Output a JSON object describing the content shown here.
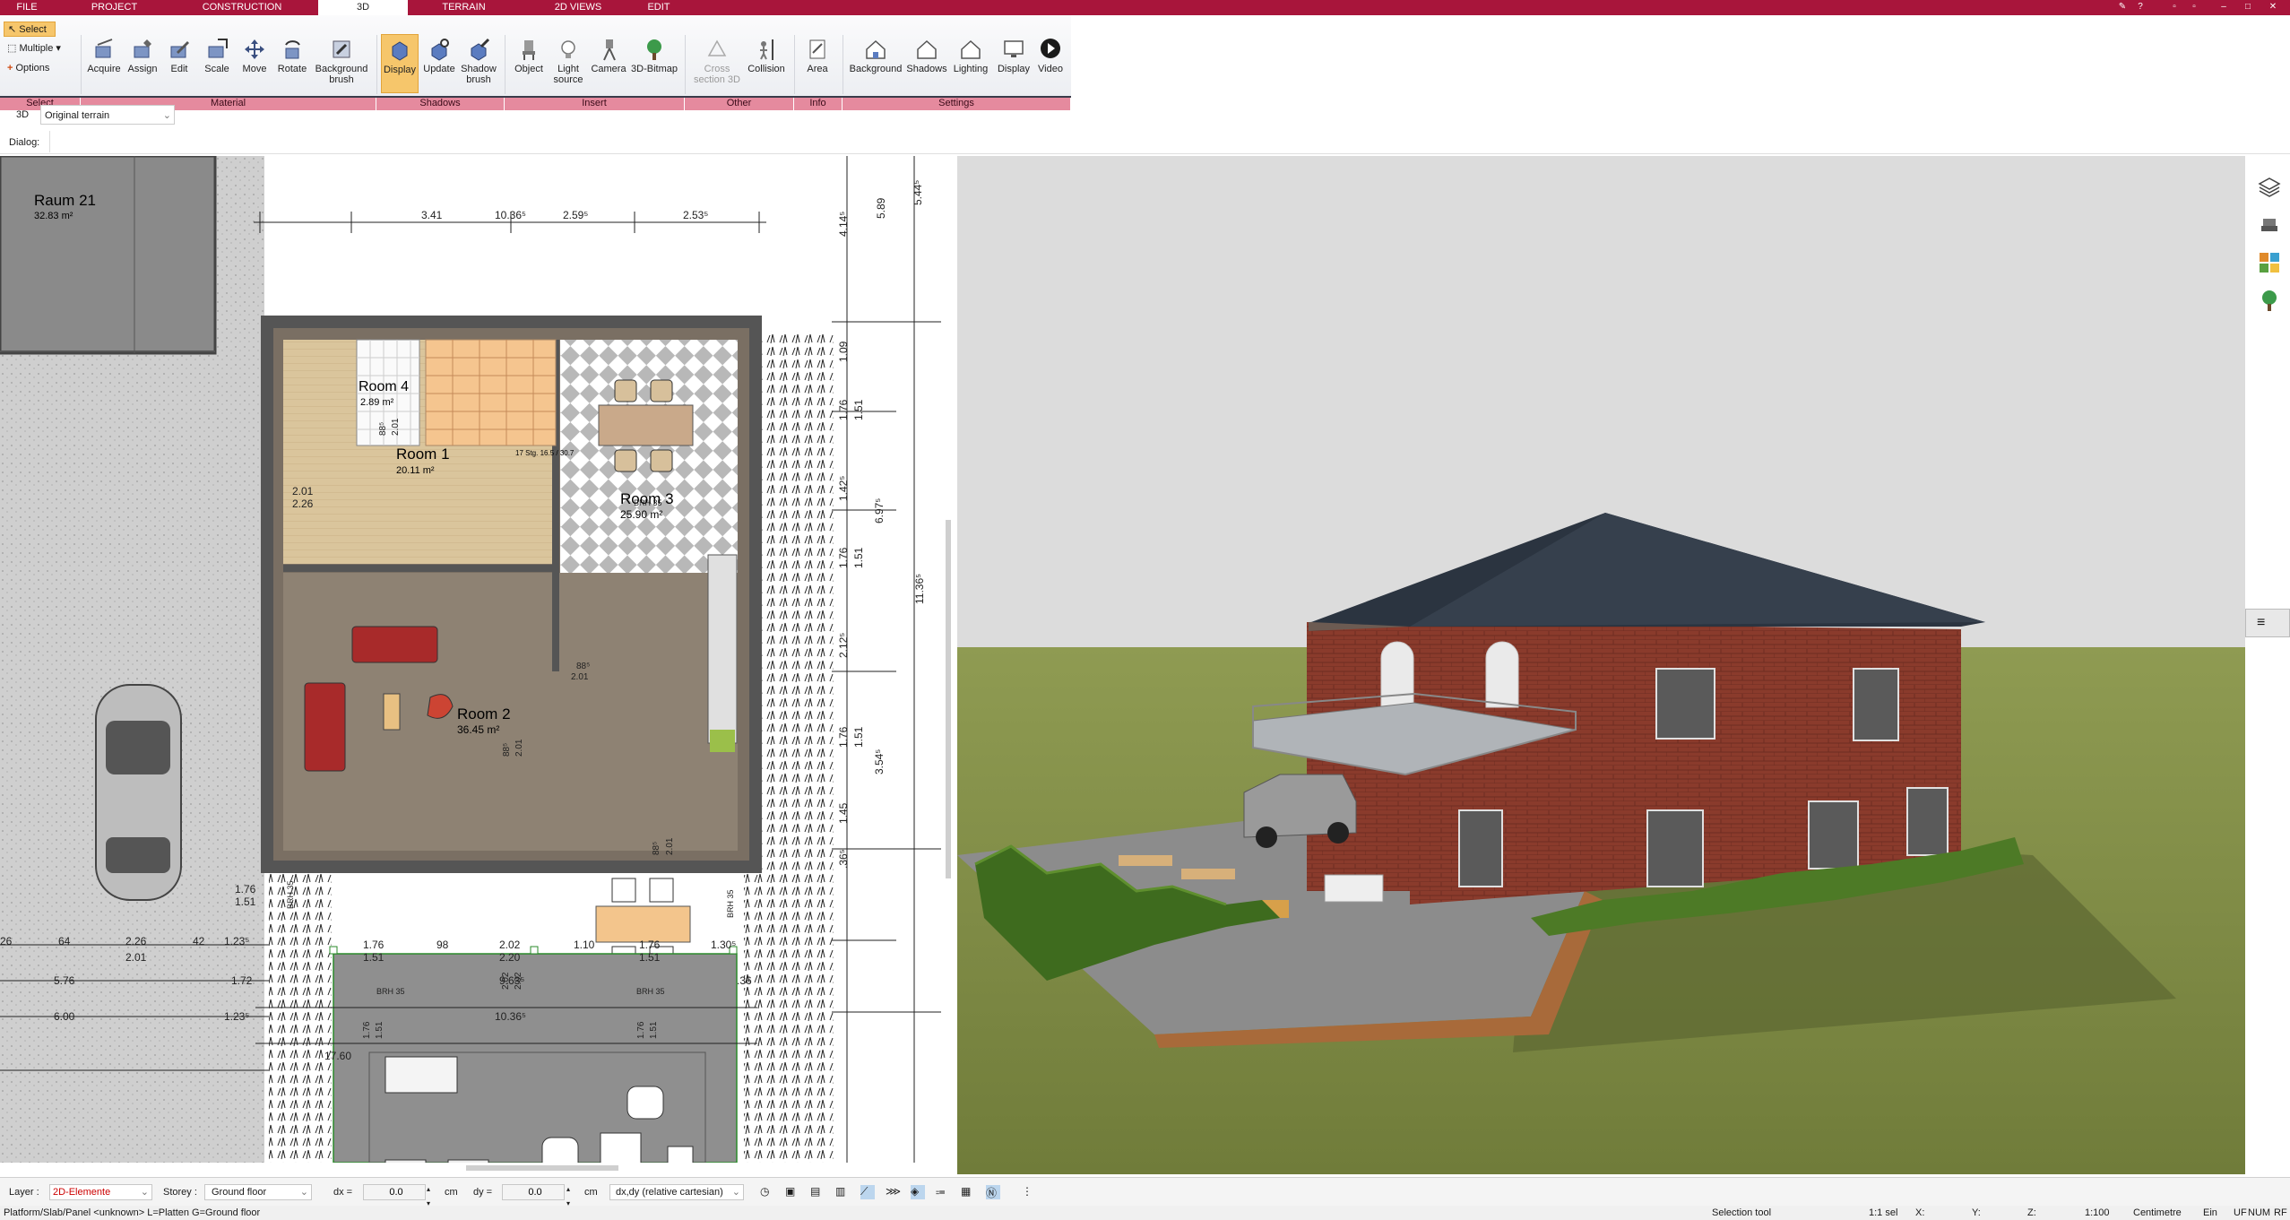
{
  "menu_tabs": [
    {
      "label": "FILE",
      "active": false
    },
    {
      "label": "PROJECT",
      "active": false
    },
    {
      "label": "CONSTRUCTION",
      "active": false
    },
    {
      "label": "3D",
      "active": true
    },
    {
      "label": "TERRAIN",
      "active": false
    },
    {
      "label": "2D VIEWS",
      "active": false
    },
    {
      "label": "EDIT",
      "active": false
    }
  ],
  "select_group": {
    "select": "Select",
    "multiple": "Multiple",
    "options": "Options",
    "group_label": "Select"
  },
  "ribbon": {
    "acquire": "Acquire",
    "assign": "Assign",
    "edit": "Edit",
    "scale": "Scale",
    "move": "Move",
    "rotate": "Rotate",
    "background_brush": "Background brush",
    "display": "Display",
    "update": "Update",
    "shadow_brush": "Shadow brush",
    "object": "Object",
    "light_source": "Light source",
    "camera": "Camera",
    "bitmap_3d": "3D-Bitmap",
    "cross_section": "Cross section 3D",
    "collision": "Collision",
    "area": "Area",
    "background": "Background",
    "shadows": "Shadows",
    "lighting": "Lighting",
    "display2": "Display",
    "video": "Video"
  },
  "groups": {
    "select": "Select",
    "material": "Material",
    "shadows": "Shadows",
    "insert": "Insert",
    "other": "Other",
    "info": "Info",
    "settings": "Settings"
  },
  "view_mode": "3D",
  "terrain_select": "Original terrain",
  "dialog_label": "Dialog:",
  "plan": {
    "rooms": [
      {
        "name": "Raum 21",
        "area": "32.83 m²"
      },
      {
        "name": "Room 4",
        "area": "2.89 m²"
      },
      {
        "name": "Room 1",
        "area": "20.11 m²"
      },
      {
        "name": "Room 3",
        "area": "25.90 m²"
      },
      {
        "name": "Room 2",
        "area": "36.45 m²"
      }
    ],
    "dims_top": [
      "3.41",
      "10.36⁵",
      "2.59⁵",
      "2.53⁵"
    ],
    "dims_right": [
      "5.89",
      "5.44⁵",
      "4.14⁵",
      "1.09",
      "1.76",
      "1.51",
      "1.42⁵",
      "6.97⁵",
      "1.76",
      "1.51",
      "2.12⁵",
      "11.36⁵",
      "1.76",
      "1.51",
      "3.54⁵",
      "1.45",
      ".36⁵"
    ],
    "dims_bottom_left": [
      "26",
      "64",
      "2.26",
      "42",
      "1.23⁵",
      "2.01",
      "5.76",
      "1.72",
      "6.00",
      "1.23⁵"
    ],
    "dims_bottom_mid": [
      "1.76",
      "98",
      "2.02",
      "1.10",
      "1.76",
      "1.30⁵",
      "1.51",
      "2.20",
      "1.51",
      "9.63⁵",
      "10.36⁵",
      "17.60",
      ".36"
    ],
    "door_labels": [
      "2.01",
      "2.26",
      "88⁵",
      "2.01",
      "88⁵",
      "2.01",
      "88⁵",
      "2.01",
      "88⁵",
      "2.01",
      "1.76",
      "1.51",
      "2.02",
      "2.02",
      "1.76",
      "1.51",
      "1.76",
      "1.51"
    ],
    "brh_labels": [
      "BRH 35",
      "BRH 35",
      "BRH 35",
      "BRH 35",
      "BRH 35"
    ],
    "stair_text": "17 Stg.\n16.5 / 30.7"
  },
  "status": {
    "layer_label": "Layer :",
    "layer_value": "2D-Elemente",
    "storey_label": "Storey :",
    "storey_value": "Ground floor",
    "dx_label": "dx =",
    "dx_value": "0.0",
    "dx_unit": "cm",
    "dy_label": "dy =",
    "dy_value": "0.0",
    "dy_unit": "cm",
    "coord_mode": "dx,dy (relative cartesian)"
  },
  "footer": {
    "left": "Platform/Slab/Panel <unknown> L=Platten G=Ground floor",
    "tool": "Selection tool",
    "sel": "1:1 sel",
    "x": "X:",
    "y": "Y:",
    "z": "Z:",
    "scale": "1:100",
    "unit": "Centimetre",
    "ein": "Ein",
    "uf": "UF",
    "num": "NUM",
    "rf": "RF"
  },
  "colors": {
    "brand": "#a8153b",
    "group_bar": "#e58a9e",
    "active_button": "#f6c66b",
    "layer_red": "#cc0000"
  }
}
